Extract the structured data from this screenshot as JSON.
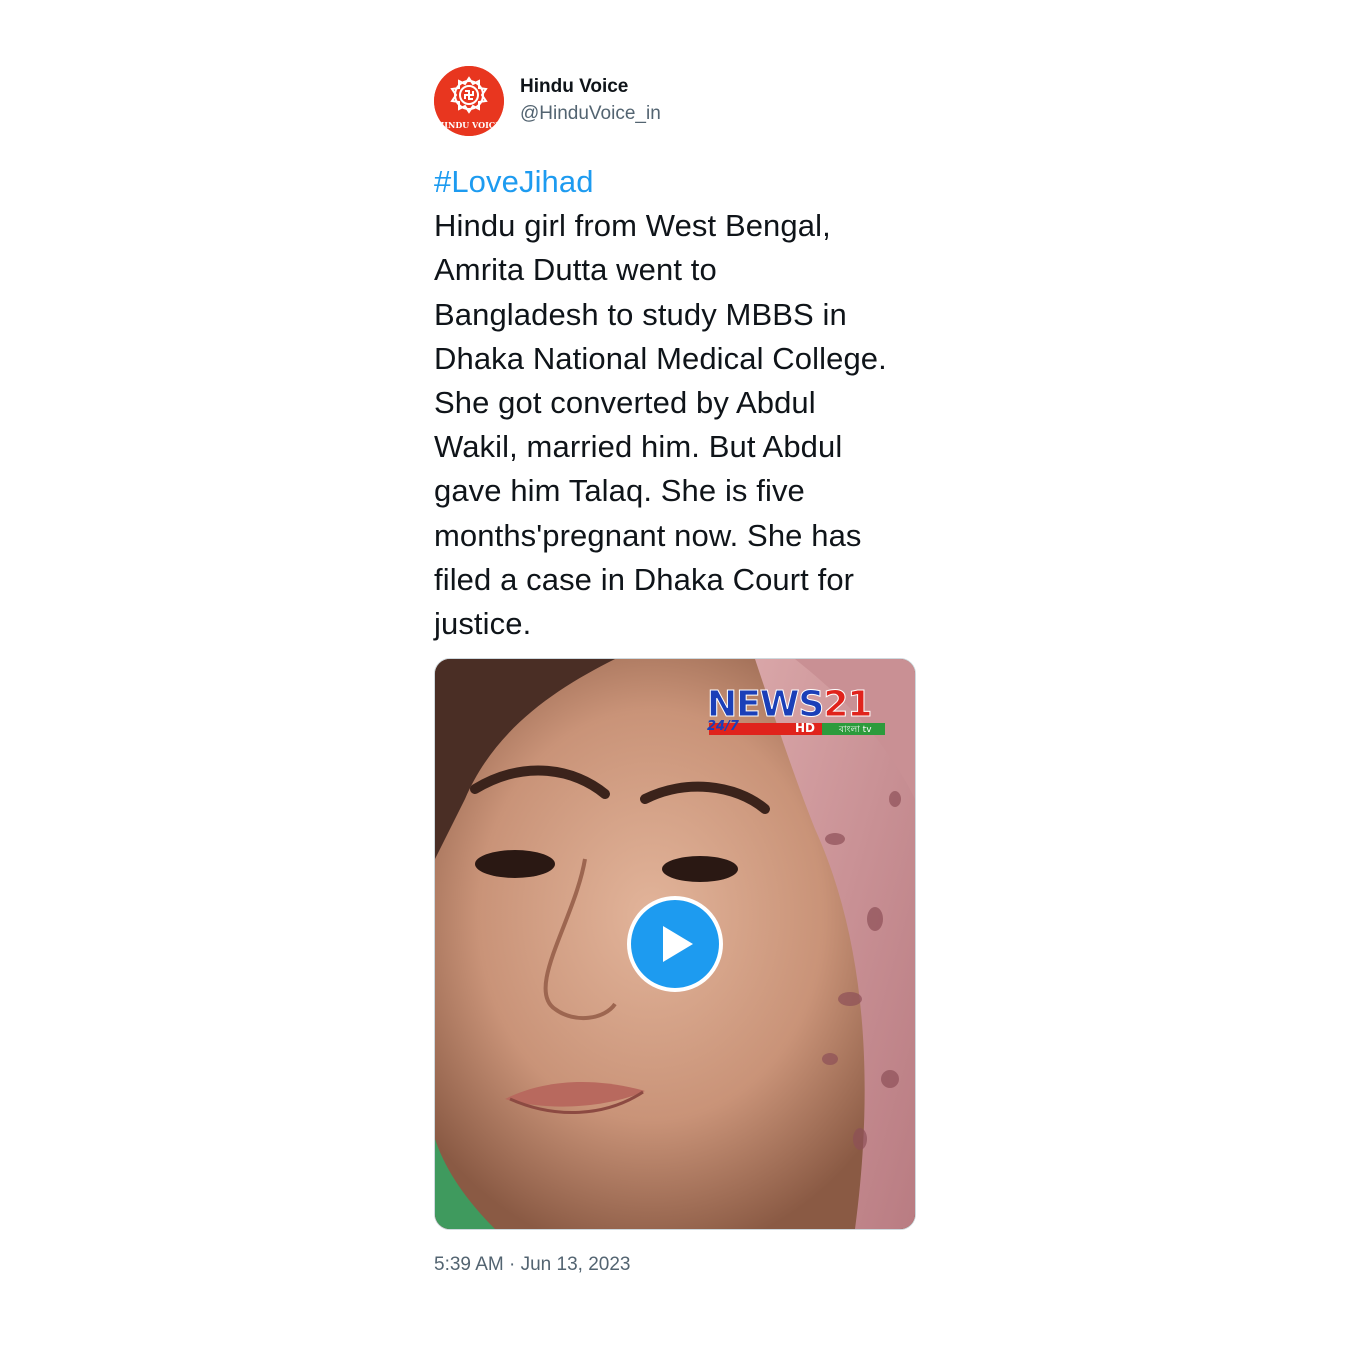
{
  "author": {
    "display_name": "Hindu Voice",
    "handle": "@HinduVoice_in",
    "avatar_icon": "hindu-voice-logo",
    "avatar_text": "HINDU VOICE"
  },
  "tweet": {
    "hashtag": "#LoveJihad",
    "lines": [
      "Hindu girl from West Bengal,",
      "Amrita Dutta went to",
      "Bangladesh to study MBBS in",
      "Dhaka National Medical College.",
      "She got converted by Abdul",
      "Wakil, married him. But Abdul",
      "gave him Talaq. She is five",
      "months'pregnant now. She has",
      "filed a case in Dhaka Court for",
      "justice."
    ],
    "timestamp": "5:39 AM · Jun 13, 2023"
  },
  "media": {
    "type": "video",
    "channel_logo": {
      "name_part1": "NEWS",
      "name_part2": "21",
      "sub_label": "24/7",
      "hd_label": "HD",
      "tv_label": "বাংলা tv"
    },
    "play_icon": "play-icon"
  },
  "colors": {
    "link": "#1d9bf0",
    "text": "#0f1419",
    "secondary": "#536471",
    "avatar_bg": "#e8361f",
    "play_bg": "#1d9bf0"
  }
}
